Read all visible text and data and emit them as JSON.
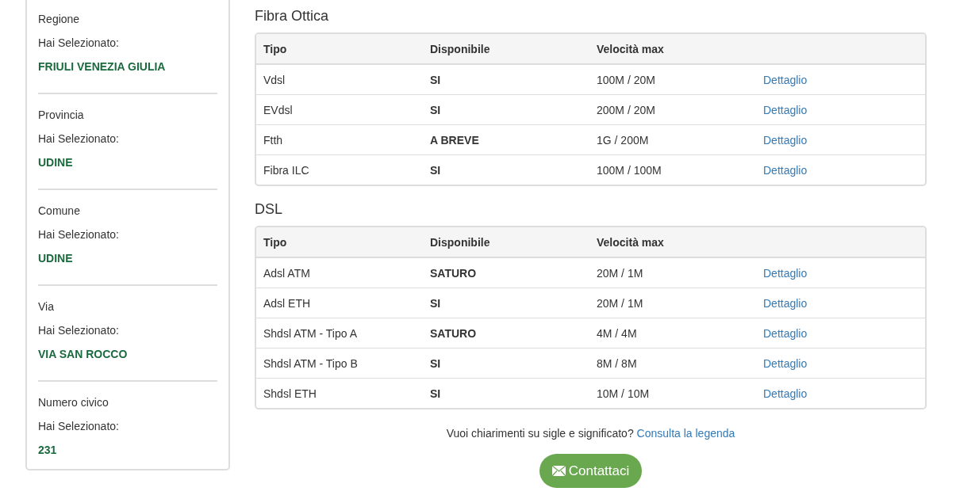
{
  "sidebar": {
    "items": [
      {
        "label": "Regione",
        "prompt": "Hai Selezionato:",
        "value": "FRIULI VENEZIA GIULIA"
      },
      {
        "label": "Provincia",
        "prompt": "Hai Selezionato:",
        "value": "UDINE"
      },
      {
        "label": "Comune",
        "prompt": "Hai Selezionato:",
        "value": "UDINE"
      },
      {
        "label": "Via",
        "prompt": "Hai Selezionato:",
        "value": "VIA SAN ROCCO"
      },
      {
        "label": "Numero civico",
        "prompt": "Hai Selezionato:",
        "value": "231"
      }
    ]
  },
  "sections": [
    {
      "title": "Fibra Ottica",
      "columns": [
        "Tipo",
        "Disponibile",
        "Velocità max"
      ],
      "rows": [
        {
          "tipo": "Vdsl",
          "disponibile": "SI",
          "velocita": "100M / 20M",
          "link": "Dettaglio"
        },
        {
          "tipo": "EVdsl",
          "disponibile": "SI",
          "velocita": "200M / 20M",
          "link": "Dettaglio"
        },
        {
          "tipo": "Ftth",
          "disponibile": "A BREVE",
          "velocita": "1G / 200M",
          "link": "Dettaglio"
        },
        {
          "tipo": "Fibra ILC",
          "disponibile": "SI",
          "velocita": "100M / 100M",
          "link": "Dettaglio"
        }
      ]
    },
    {
      "title": "DSL",
      "columns": [
        "Tipo",
        "Disponibile",
        "Velocità max"
      ],
      "rows": [
        {
          "tipo": "Adsl ATM",
          "disponibile": "SATURO",
          "velocita": "20M / 1M",
          "link": "Dettaglio"
        },
        {
          "tipo": "Adsl ETH",
          "disponibile": "SI",
          "velocita": "20M / 1M",
          "link": "Dettaglio"
        },
        {
          "tipo": "Shdsl ATM - Tipo A",
          "disponibile": "SATURO",
          "velocita": "4M / 4M",
          "link": "Dettaglio"
        },
        {
          "tipo": "Shdsl ATM - Tipo B",
          "disponibile": "SI",
          "velocita": "8M / 8M",
          "link": "Dettaglio"
        },
        {
          "tipo": "Shdsl ETH",
          "disponibile": "SI",
          "velocita": "10M / 10M",
          "link": "Dettaglio"
        }
      ]
    }
  ],
  "legend": {
    "text": "Vuoi chiarimenti su sigle e significato?",
    "link": "Consulta la legenda"
  },
  "contact_button": "Contattaci"
}
